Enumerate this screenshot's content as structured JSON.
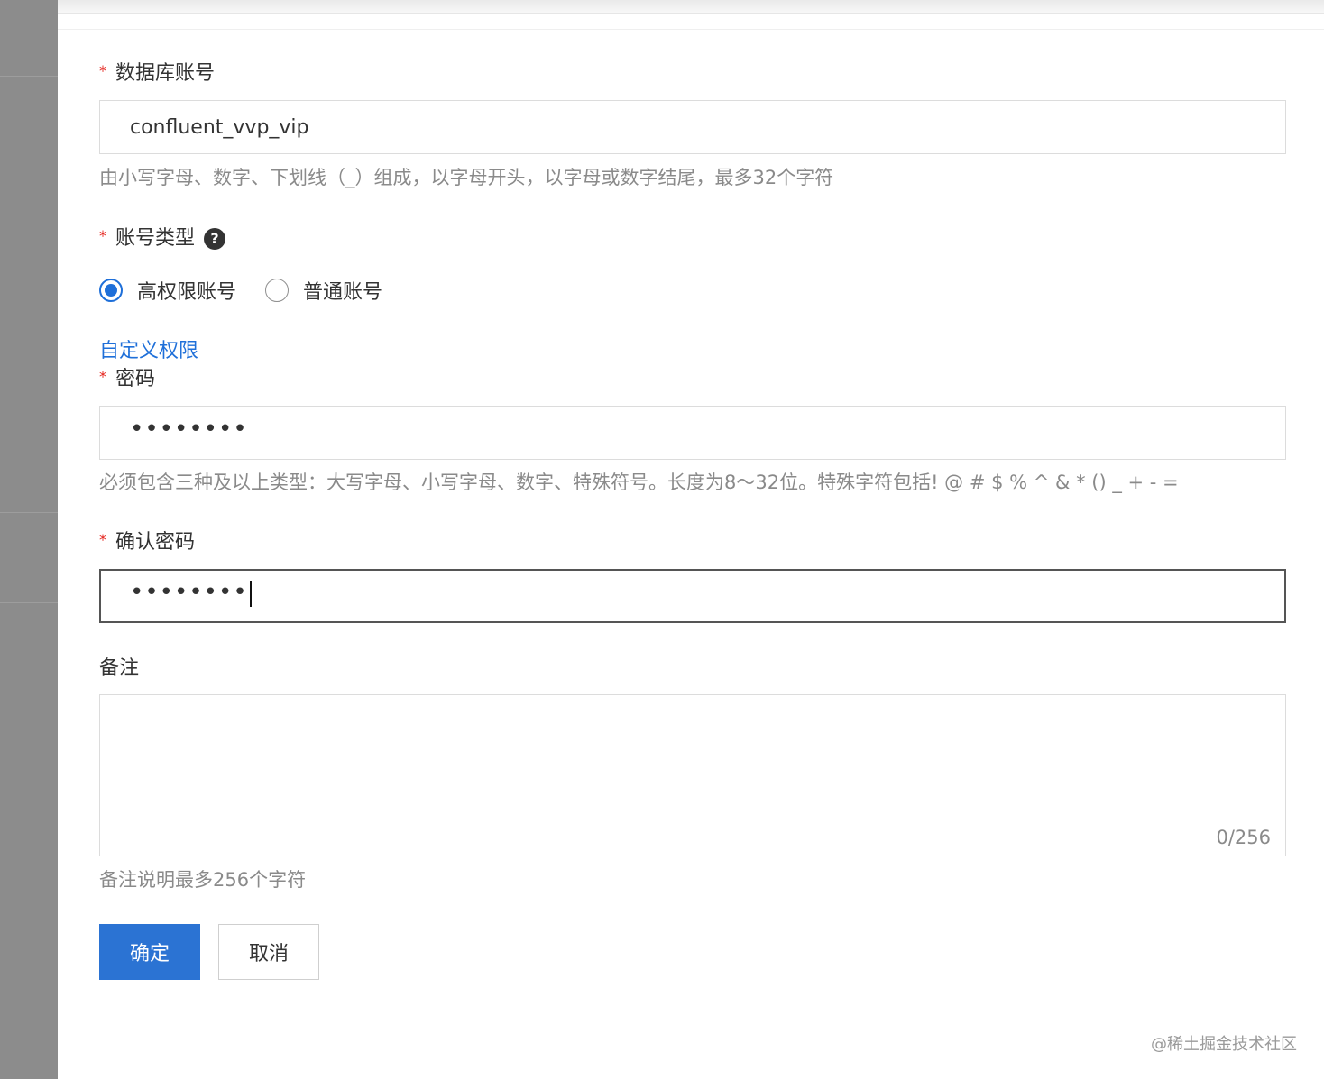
{
  "form": {
    "account": {
      "required_mark": "*",
      "label": "数据库账号",
      "value": "confluent_vvp_vip",
      "hint": "由小写字母、数字、下划线（_）组成，以字母开头，以字母或数字结尾，最多32个字符"
    },
    "account_type": {
      "required_mark": "*",
      "label": "账号类型",
      "help_icon_glyph": "?",
      "options": [
        {
          "label": "高权限账号",
          "checked": true
        },
        {
          "label": "普通账号",
          "checked": false
        }
      ]
    },
    "custom_permission_link": "自定义权限",
    "password": {
      "required_mark": "*",
      "label": "密码",
      "masked_value": "••••••••",
      "hint": "必须包含三种及以上类型：大写字母、小写字母、数字、特殊符号。长度为8～32位。特殊字符包括! @ # $ % ^ & * () _ + - ="
    },
    "confirm_password": {
      "required_mark": "*",
      "label": "确认密码",
      "masked_value": "••••••••"
    },
    "remark": {
      "label": "备注",
      "value": "",
      "counter": "0/256",
      "hint": "备注说明最多256个字符"
    }
  },
  "buttons": {
    "confirm": "确定",
    "cancel": "取消"
  },
  "watermark": "@稀土掘金技术社区",
  "colors": {
    "required": "#e5231c",
    "primary": "#2b73d3",
    "link": "#1e6fd9",
    "hint": "#8a8a8a"
  }
}
